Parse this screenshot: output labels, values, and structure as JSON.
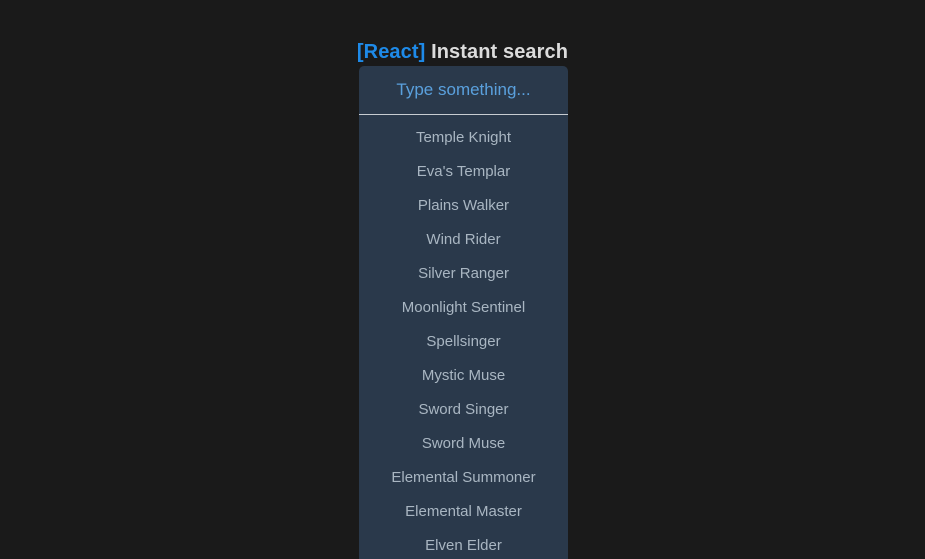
{
  "page": {
    "background_color": "#1a1a1a"
  },
  "header": {
    "tag_label": "[React]",
    "tag_color": "#1e8ae8",
    "title": " Instant search",
    "title_color": "#dcdcdc"
  },
  "search": {
    "placeholder": "Type something...",
    "value": "",
    "placeholder_color": "#5aa0dd",
    "panel_background": "#2a394b",
    "divider_color": "#c7ccd1"
  },
  "results": {
    "item_color": "#a9b6c2",
    "items": [
      {
        "label": "Temple Knight"
      },
      {
        "label": "Eva's Templar"
      },
      {
        "label": "Plains Walker"
      },
      {
        "label": "Wind Rider"
      },
      {
        "label": "Silver Ranger"
      },
      {
        "label": "Moonlight Sentinel"
      },
      {
        "label": "Spellsinger"
      },
      {
        "label": "Mystic Muse"
      },
      {
        "label": "Sword Singer"
      },
      {
        "label": "Sword Muse"
      },
      {
        "label": "Elemental Summoner"
      },
      {
        "label": "Elemental Master"
      },
      {
        "label": "Elven Elder"
      }
    ]
  }
}
